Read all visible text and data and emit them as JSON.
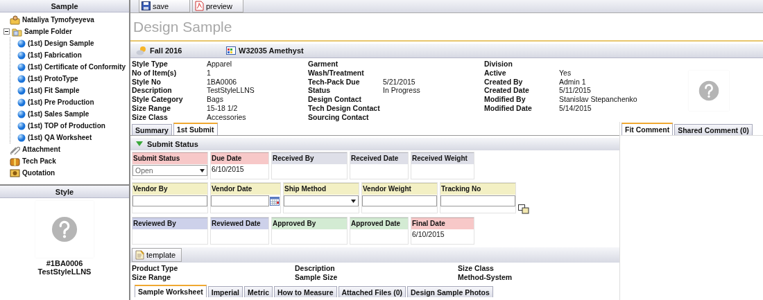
{
  "sidebar": {
    "title": "Sample",
    "tree": [
      {
        "label": "Nataliya Tymofyeyeva",
        "kind": "user"
      },
      {
        "label": "Sample Folder",
        "kind": "folder",
        "expanded": true,
        "children": [
          {
            "label": "(1st) Design Sample",
            "kind": "sample"
          },
          {
            "label": "(1st) Fabrication",
            "kind": "sample"
          },
          {
            "label": "(1st) Certificate of Conformity",
            "kind": "sample"
          },
          {
            "label": "(1st) ProtoType",
            "kind": "sample"
          },
          {
            "label": "(1st) Fit Sample",
            "kind": "sample"
          },
          {
            "label": "(1st) Pre Production",
            "kind": "sample"
          },
          {
            "label": "(1st) Sales Sample",
            "kind": "sample"
          },
          {
            "label": "(1st) TOP of Production",
            "kind": "sample"
          },
          {
            "label": "(1st) QA Worksheet",
            "kind": "sample"
          }
        ]
      },
      {
        "label": "Attachment",
        "kind": "attachment"
      },
      {
        "label": "Tech Pack",
        "kind": "techpack"
      },
      {
        "label": "Quotation",
        "kind": "quotation"
      }
    ]
  },
  "style_panel": {
    "title": "Style",
    "style_no": "#1BA0006",
    "description": "TestStyleLLNS"
  },
  "toolbar": [
    {
      "label": "save",
      "kind": "save"
    },
    {
      "label": "preview",
      "kind": "pdf"
    }
  ],
  "page_title": "Design Sample",
  "header_bar": {
    "season": "Fall 2016",
    "color_name": "W32035 Amethyst"
  },
  "details": [
    [
      {
        "label": "Style Type",
        "value": "Apparel"
      },
      {
        "label": "No of Item(s)",
        "value": "1"
      },
      {
        "label": "Style No",
        "value": "1BA0006"
      },
      {
        "label": "Description",
        "value": "TestStyleLLNS"
      },
      {
        "label": "Style Category",
        "value": "Bags"
      },
      {
        "label": "Size Range",
        "value": "15-18 1/2"
      },
      {
        "label": "Size Class",
        "value": "Accessories"
      }
    ],
    [
      {
        "label": "Garment"
      },
      {
        "label": "Wash/Treatment"
      },
      {
        "label": "Tech-Pack Due",
        "value": "5/21/2015"
      },
      {
        "label": "Status",
        "value": "In Progress"
      },
      {
        "label": "Design Contact"
      },
      {
        "label": "Tech Design Contact"
      },
      {
        "label": "Sourcing Contact"
      }
    ],
    [
      {
        "label": "Division"
      },
      {
        "label": "Active",
        "value": "Yes"
      },
      {
        "label": "Created By",
        "value": "Admin 1"
      },
      {
        "label": "Created Date",
        "value": "5/11/2015"
      },
      {
        "label": "Modified By",
        "value": "Stanislav Stepanchenko"
      },
      {
        "label": "Modified Date",
        "value": "5/14/2015"
      }
    ]
  ],
  "tabs": [
    {
      "label": "Summary",
      "selected": false
    },
    {
      "label": "1st Submit",
      "selected": true
    }
  ],
  "comment_tabs": [
    {
      "label": "Fit Comment",
      "selected": true
    },
    {
      "label": "Shared Comment (0)",
      "selected": false
    }
  ],
  "section": {
    "title": "Submit Status",
    "expanded": true
  },
  "field_rows": [
    [
      {
        "label": "Submit Status",
        "color": "#f7c8c8",
        "kind": "select",
        "value": "Open"
      },
      {
        "label": "Due Date",
        "color": "#f7c8c8",
        "kind": "text",
        "value": "6/10/2015"
      },
      {
        "label": "Received By",
        "color": "#dedfe8",
        "kind": "text"
      },
      {
        "label": "Received Date",
        "color": "#dedfe8",
        "kind": "text"
      },
      {
        "label": "Received Weight",
        "color": "#dedfe8",
        "kind": "text"
      }
    ],
    [
      {
        "label": "Vendor By",
        "color": "#f3f0c4",
        "kind": "input"
      },
      {
        "label": "Vendor Date",
        "color": "#f3f0c4",
        "kind": "date"
      },
      {
        "label": "Ship Method",
        "color": "#f3f0c4",
        "kind": "select"
      },
      {
        "label": "Vendor Weight",
        "color": "#f3f0c4",
        "kind": "input"
      },
      {
        "label": "Tracking No",
        "color": "#f3f0c4",
        "kind": "input"
      }
    ],
    [
      {
        "label": "Reviewed By",
        "color": "#cdd1ea",
        "kind": "text"
      },
      {
        "label": "Reviewed Date",
        "color": "#cdd1ea",
        "kind": "text"
      },
      {
        "label": "Approved By",
        "color": "#d3ebd3",
        "kind": "text"
      },
      {
        "label": "Approved Date",
        "color": "#d3ebd3",
        "kind": "text"
      },
      {
        "label": "Final Date",
        "color": "#f7c8c8",
        "kind": "text",
        "value": "6/10/2015"
      }
    ]
  ],
  "template_button": "template",
  "product_fields": [
    [
      "Product Type",
      "Size Range"
    ],
    [
      "Description",
      "Sample Size"
    ],
    [
      "Size Class",
      "Method-System"
    ]
  ],
  "bottom_tabs": [
    {
      "label": "Sample Worksheet",
      "selected": true
    },
    {
      "label": "Imperial",
      "selected": false
    },
    {
      "label": "Metric",
      "selected": false
    },
    {
      "label": "How to Measure",
      "selected": false
    },
    {
      "label": "Attached Files (0)",
      "selected": false
    },
    {
      "label": "Design Sample Photos",
      "selected": false
    }
  ]
}
